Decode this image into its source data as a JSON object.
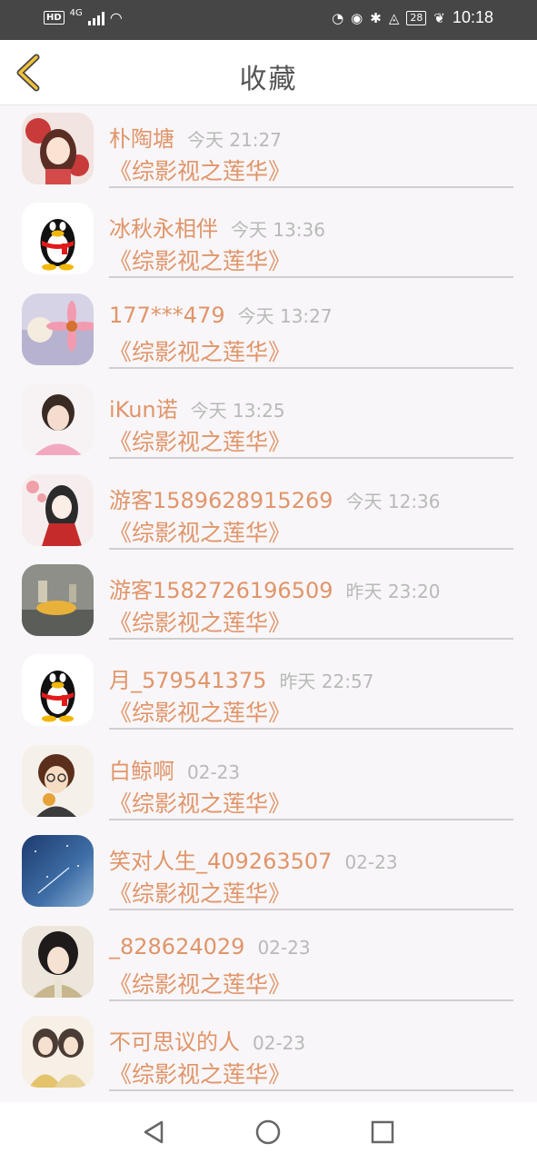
{
  "status_bar": {
    "hd": "HD",
    "signal": "4G",
    "battery": "28",
    "time": "10:18"
  },
  "header": {
    "title": "收藏"
  },
  "items": [
    {
      "name": "朴陶塘",
      "time": "今天 21:27",
      "work": "《综影视之莲华》"
    },
    {
      "name": "冰秋永相伴",
      "time": "今天 13:36",
      "work": "《综影视之莲华》"
    },
    {
      "name": "177***479",
      "time": "今天 13:27",
      "work": "《综影视之莲华》"
    },
    {
      "name": "iKun诺",
      "time": "今天 13:25",
      "work": "《综影视之莲华》"
    },
    {
      "name": "游客1589628915269",
      "time": "今天 12:36",
      "work": "《综影视之莲华》"
    },
    {
      "name": "游客1582726196509",
      "time": "昨天 23:20",
      "work": "《综影视之莲华》"
    },
    {
      "name": "月_579541375",
      "time": "昨天 22:57",
      "work": "《综影视之莲华》"
    },
    {
      "name": "白鲸啊",
      "time": "02-23",
      "work": "《综影视之莲华》"
    },
    {
      "name": "笑对人生_409263507",
      "time": "02-23",
      "work": "《综影视之莲华》"
    },
    {
      "name": "_828624029",
      "time": "02-23",
      "work": "《综影视之莲华》"
    },
    {
      "name": "不可思议的人",
      "time": "02-23",
      "work": "《综影视之莲华》"
    }
  ]
}
